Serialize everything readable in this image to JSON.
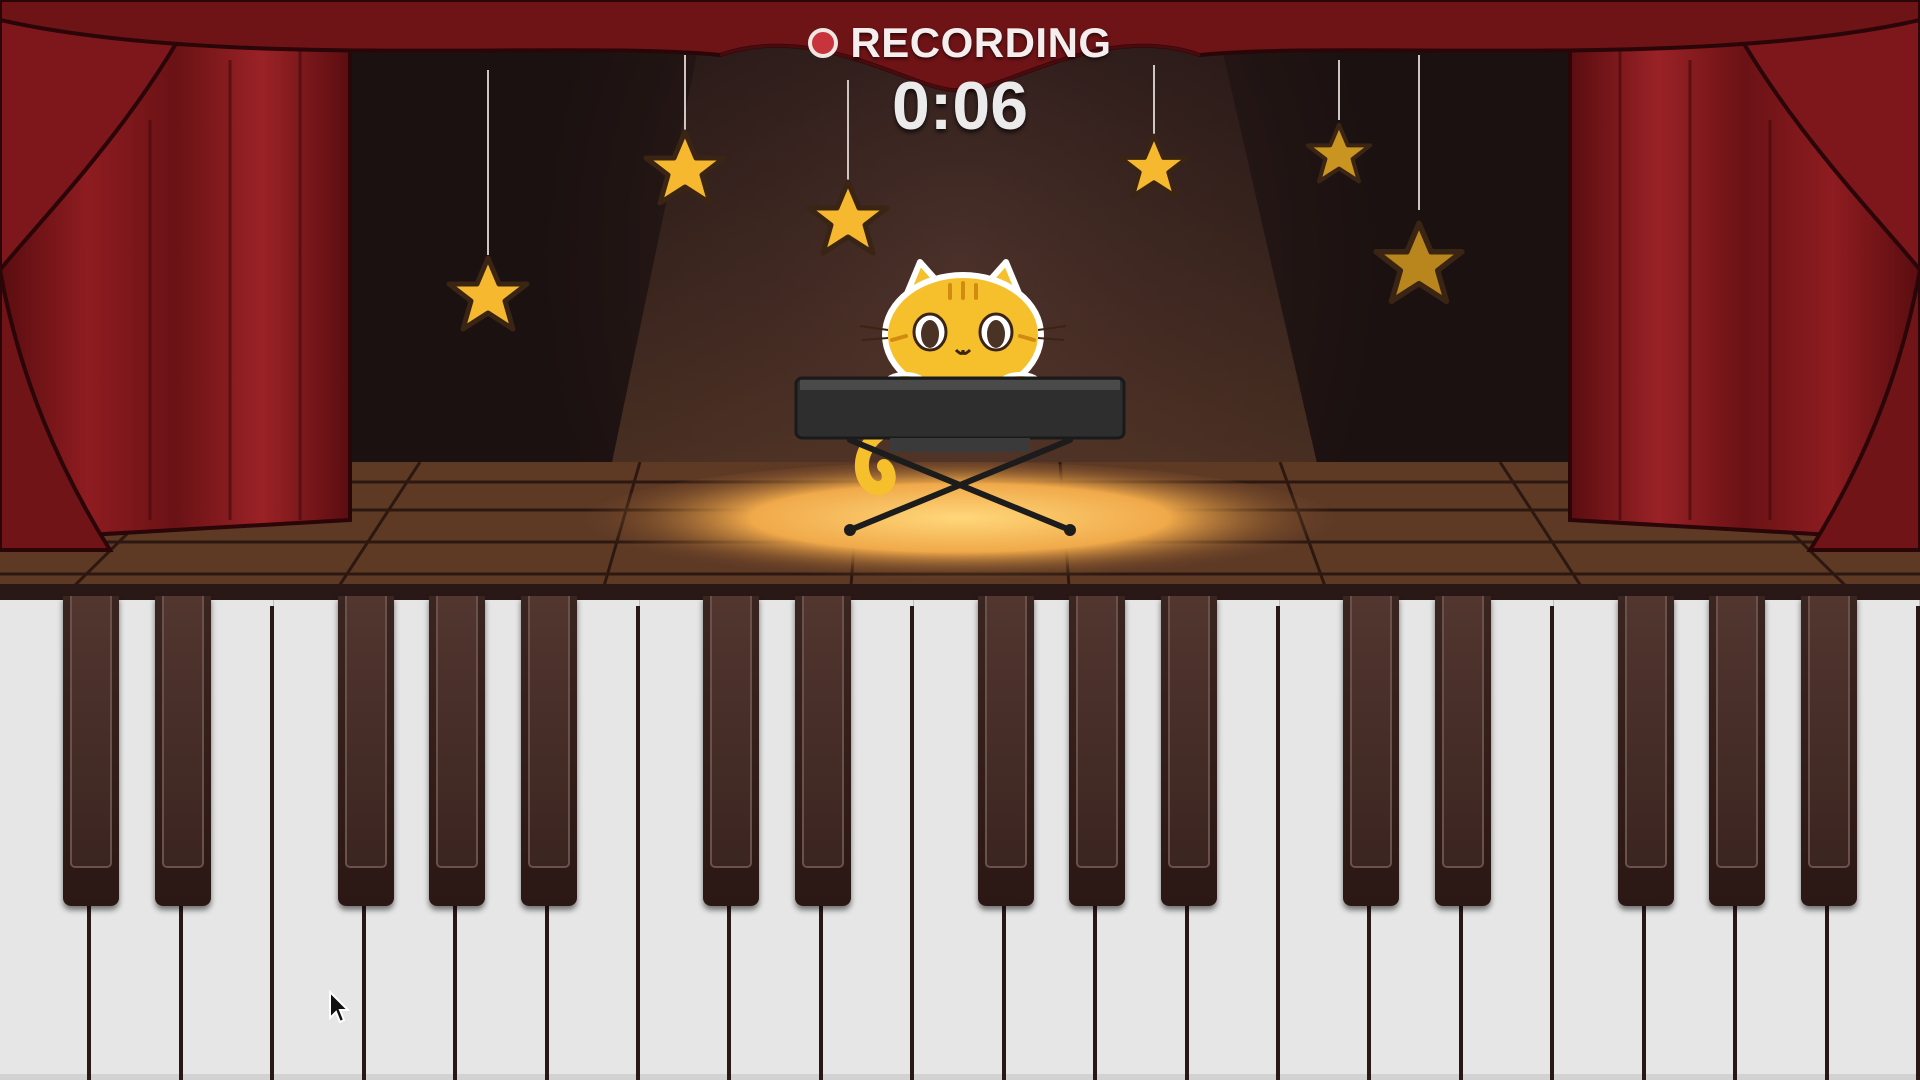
{
  "hud": {
    "status_label": "RECORDING",
    "timer": "0:06"
  },
  "icons": {
    "record": "record-dot-icon",
    "star": "star-icon",
    "cursor": "mouse-pointer-icon"
  },
  "colors": {
    "curtain": "#7a1518",
    "record_dot": "#c8343c",
    "star_fill": "#f5b82e",
    "cat_fill": "#f6c02d",
    "white_key": "#e6e6e6",
    "black_key": "#3b2520"
  },
  "keyboard": {
    "white_keys": 21,
    "black_keys": 15
  }
}
